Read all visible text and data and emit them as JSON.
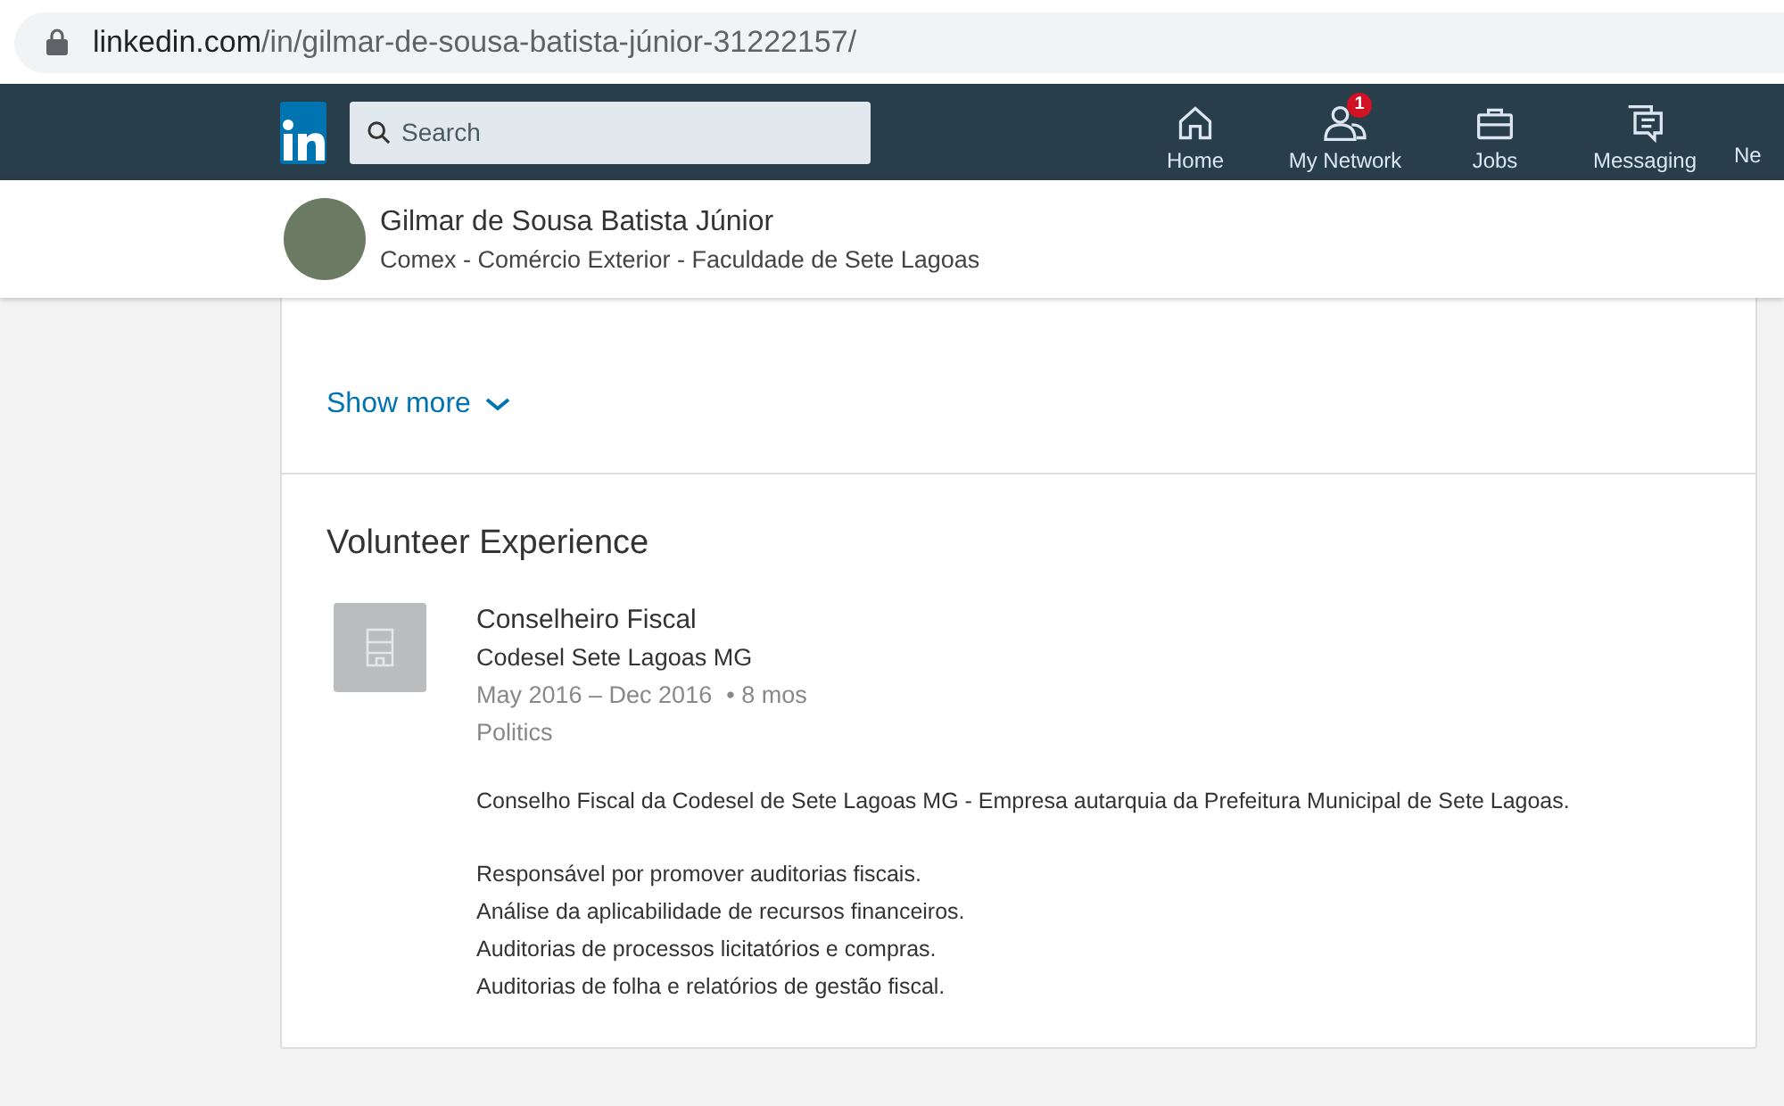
{
  "address_bar": {
    "url_host": "linkedin.com",
    "url_path": "/in/gilmar-de-sousa-batista-júnior-31222157/"
  },
  "nav": {
    "search": {
      "placeholder": "Search"
    },
    "items": [
      {
        "kind": "home",
        "label": "Home"
      },
      {
        "kind": "network",
        "label": "My Network",
        "badge": "1"
      },
      {
        "kind": "jobs",
        "label": "Jobs"
      },
      {
        "kind": "messaging",
        "label": "Messaging"
      },
      {
        "kind": "cut",
        "label": "Ne"
      }
    ]
  },
  "profile_header": {
    "name": "Gilmar de Sousa Batista Júnior",
    "headline": "Comex - Comércio Exterior - Faculdade de Sete Lagoas"
  },
  "show_more": {
    "label": "Show more"
  },
  "volunteer": {
    "heading": "Volunteer Experience",
    "entries": [
      {
        "role": "Conselheiro Fiscal",
        "organization": "Codesel Sete Lagoas MG",
        "dates": "May 2016 – Dec 2016",
        "duration": "• 8 mos",
        "cause": "Politics",
        "description": [
          [
            "Conselho Fiscal da Codesel de Sete Lagoas MG - Empresa autarquia da Prefeitura Municipal de Sete Lagoas."
          ],
          [
            "Responsável por promover auditorias fiscais.",
            "Análise da aplicabilidade de recursos financeiros.",
            "Auditorias de processos licitatórios e compras.",
            "Auditorias de folha e relatórios de gestão fiscal."
          ]
        ]
      }
    ]
  }
}
